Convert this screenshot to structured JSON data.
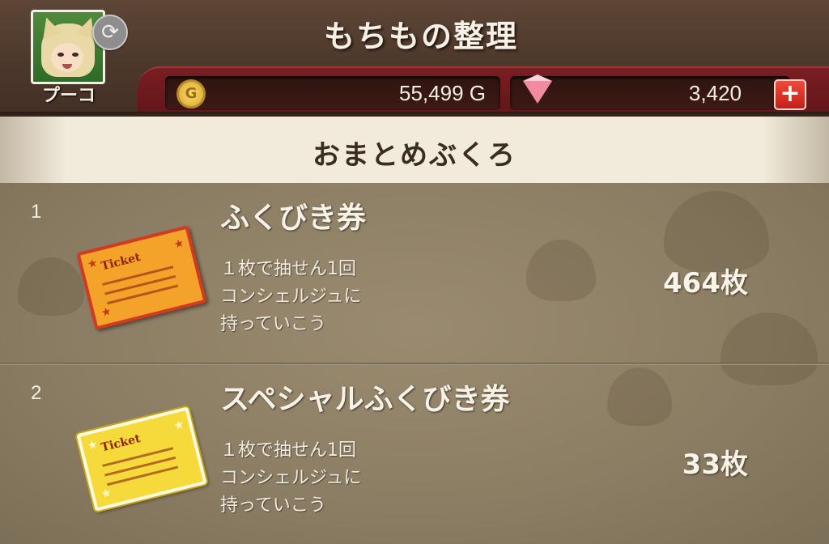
{
  "header": {
    "title": "もちもの整理",
    "player_name": "プーコ",
    "gold": {
      "value": "55,499 G",
      "icon": "gold-coin-icon"
    },
    "gems": {
      "value": "3,420",
      "icon": "gem-icon"
    }
  },
  "section": {
    "title": "おまとめぶくろ"
  },
  "items": [
    {
      "index": "1",
      "name": "ふくびき券",
      "desc_lines": [
        "１枚で抽せん1回",
        "コンシェルジュに",
        "持っていこう"
      ],
      "count": "464枚",
      "icon": "ticket-icon",
      "color": "#f4a32a"
    },
    {
      "index": "2",
      "name": "スペシャルふくびき券",
      "desc_lines": [
        "１枚で抽せん1回",
        "コンシェルジュに",
        "持っていこう"
      ],
      "count": "33枚",
      "icon": "special-ticket-icon",
      "color": "#f6d93a"
    }
  ],
  "colors": {
    "header_bg": "#4c382b",
    "currency_bar": "#7a1e22",
    "plus_button": "#e03a2c",
    "section_bg": "#f1ebdb",
    "list_bg": "#8b7d63"
  }
}
